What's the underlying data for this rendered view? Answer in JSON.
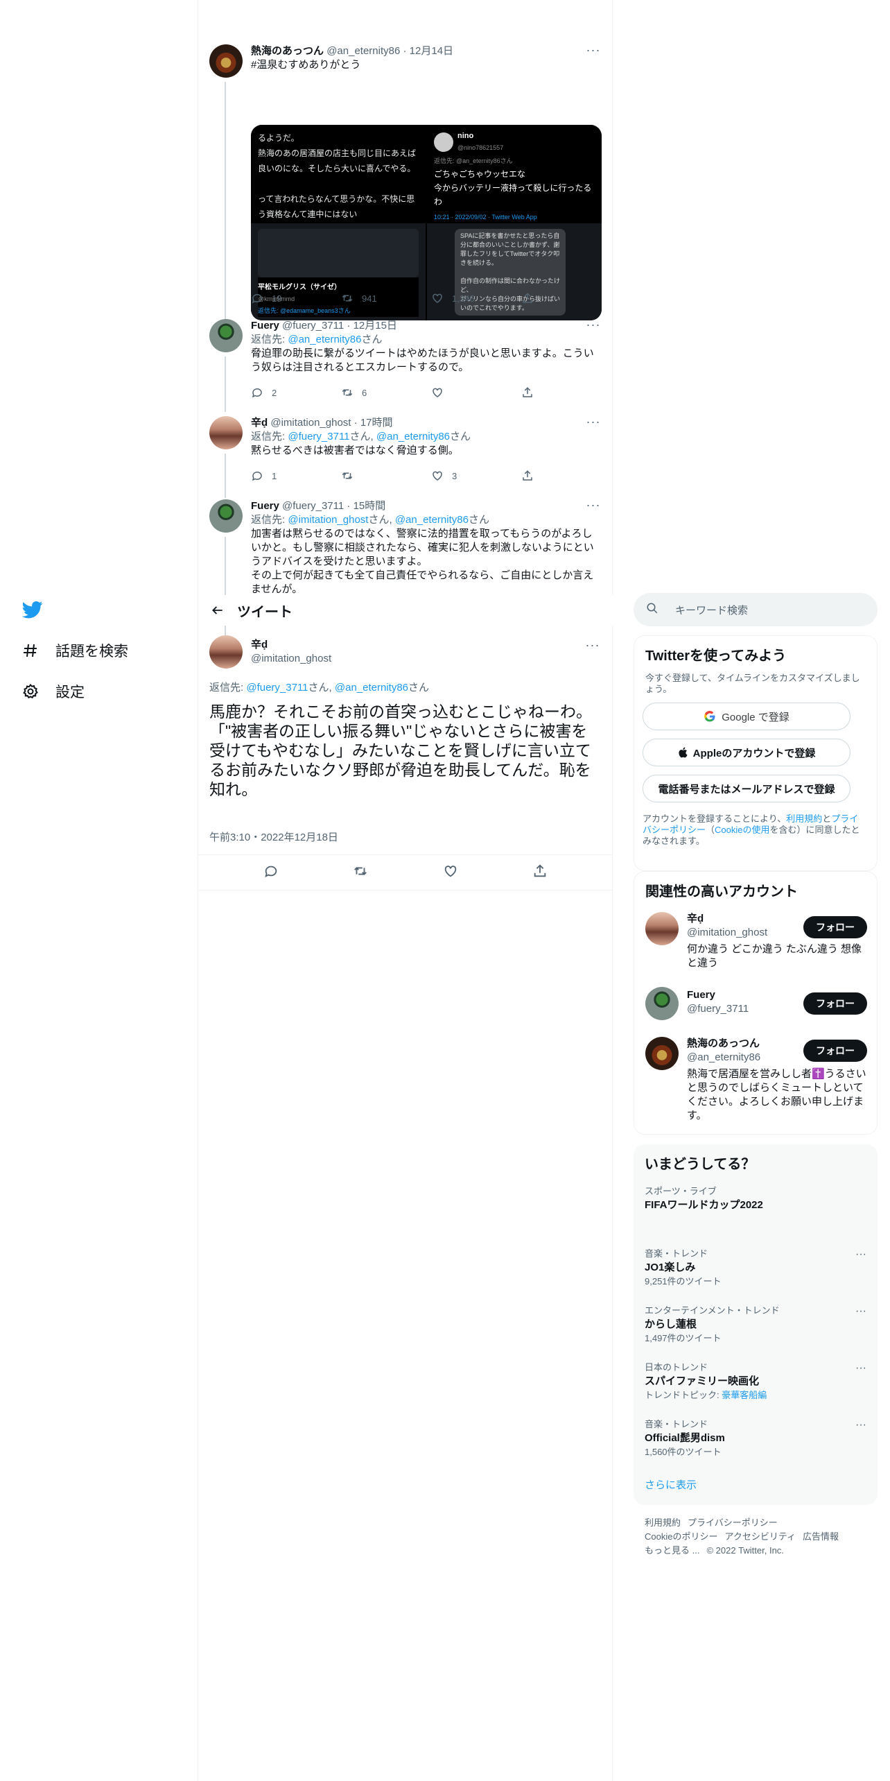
{
  "nav": {
    "explore_label": "話題を検索",
    "settings_label": "設定"
  },
  "header": {
    "title": "ツイート"
  },
  "thread": [
    {
      "name": "熱海のあっつん",
      "handle": "@an_eternity86",
      "time": "12月14日",
      "hashtag": "#温泉むすめありがとう",
      "media": {
        "img1_text": "るようだ。\n熱海のあの居酒屋の店主も同じ目にあえば良いのにな。そしたら大いに喜んでやる。\n\nって言われたらなんて思うかな。不快に思う資格なんて連中にはない",
        "img2_name": "nino",
        "img2_handle": "@nino78621557",
        "img2_reply": "返信先: @an_eternity86さん",
        "img2_text": "ごちゃごちゃウッセエな\n今からバッテリー液持って殺しに行ったるわ",
        "img2_meta": "10:21 · 2022/09/02 · Twitter Web App",
        "img3_name": "平松モルグリス（サイゼ）",
        "img3_handle": "@kmmkmmd",
        "img3_reply": "返信先: @edamame_beans3さん",
        "img4_text": "SPAに記事を書かせたと思ったら自分に都合のいいことしか書かず、謝罪したフリをしてTwitterでオタク叩きを続ける。\n\n自作自の制作は間に合わなかったけど、\nガソリンなら自分の車から抜けばいいのでこれでやります。"
      },
      "replies": "19",
      "retweets": "941",
      "likes": "1,346"
    },
    {
      "name": "Fuery",
      "handle": "@fuery_3711",
      "time": "12月15日",
      "reply_prefix": "返信先: ",
      "reply_to": "@an_eternity86",
      "reply_suffix": "さん",
      "text": "脅迫罪の助長に繋がるツイートはやめたほうが良いと思いますよ。こういう奴らは注目されるとエスカレートするので。",
      "replies": "2",
      "retweets": "6",
      "likes": ""
    },
    {
      "name": "辛ḍ",
      "handle": "@imitation_ghost",
      "time": "17時間",
      "reply_prefix": "返信先: ",
      "reply_to": "@fuery_3711",
      "reply_mid": "さん, ",
      "reply_to2": "@an_eternity86",
      "reply_suffix": "さん",
      "text": "黙らせるべきは被害者ではなく脅迫する側。",
      "replies": "1",
      "retweets": "",
      "likes": "3"
    },
    {
      "name": "Fuery",
      "handle": "@fuery_3711",
      "time": "15時間",
      "reply_prefix": "返信先: ",
      "reply_to": "@imitation_ghost",
      "reply_mid": "さん, ",
      "reply_to2": "@an_eternity86",
      "reply_suffix": "さん",
      "text": "加害者は黙らせるのではなく、警察に法的措置を取ってもらうのがよろしいかと。もし警察に相談されたなら、確実に犯人を刺激しないようにというアドバイスを受けたと思いますよ。\nその上で何が起きても全て自己責任でやられるなら、ご自由にとしか言えませんが。"
    }
  ],
  "focus": {
    "name": "辛ḍ",
    "handle": "@imitation_ghost",
    "reply_prefix": "返信先: ",
    "reply_to": "@fuery_3711",
    "reply_mid": "さん, ",
    "reply_to2": "@an_eternity86",
    "reply_suffix": "さん",
    "text": "馬鹿か？それこそお前の首突っ込むとこじゃねーわ。\n「\"被害者の正しい振る舞い\"じゃないとさらに被害を受けてもやむなし」みたいなことを賢しげに言い立てるお前みたいなクソ野郎が脅迫を助長してんだ。恥を知れ。",
    "timestamp": "午前3:10・2022年12月18日"
  },
  "search": {
    "placeholder": "キーワード検索"
  },
  "signup": {
    "title": "Twitterを使ってみよう",
    "subtitle": "今すぐ登録して、タイムラインをカスタマイズしましょう。",
    "google": "Google で登録",
    "apple": "Appleのアカウントで登録",
    "phone": "電話番号またはメールアドレスで登録",
    "terms_prefix": "アカウントを登録することにより、",
    "terms_link1": "利用規約",
    "terms_mid1": "と",
    "terms_link2": "プライバシーポリシー",
    "terms_mid2": "（",
    "terms_link3": "Cookieの使用",
    "terms_suffix": "を含む）に同意したとみなされます。"
  },
  "related": {
    "title": "関連性の高いアカウント",
    "follow_label": "フォロー",
    "users": [
      {
        "name": "辛ḍ",
        "handle": "@imitation_ghost",
        "bio": "何か違う どこか違う たぶん違う 想像と違う"
      },
      {
        "name": "Fuery",
        "handle": "@fuery_3711",
        "bio": ""
      },
      {
        "name": "熱海のあっつん",
        "handle": "@an_eternity86",
        "bio": "熱海で居酒屋を営みしし者✝️うるさいと思うのでしばらくミュートしといてください。よろしくお願い申し上げます。"
      }
    ]
  },
  "trends": {
    "title": "いまどうしてる？",
    "items": [
      {
        "category": "スポーツ・ライブ",
        "name": "FIFAワールドカップ2022",
        "count": ""
      },
      {
        "category": "音楽・トレンド",
        "name": "JO1楽しみ",
        "count": "9,251件のツイート"
      },
      {
        "category": "エンターテインメント・トレンド",
        "name": "からし蓮根",
        "count": "1,497件のツイート"
      },
      {
        "category": "日本のトレンド",
        "name": "スパイファミリー映画化",
        "topic_prefix": "トレンドトピック: ",
        "topic": "豪華客船編"
      },
      {
        "category": "音楽・トレンド",
        "name": "Official髭男dism",
        "count": "1,560件のツイート"
      }
    ],
    "show_more": "さらに表示"
  },
  "footer": {
    "terms": "利用規約",
    "privacy": "プライバシーポリシー",
    "cookie": "Cookieのポリシー",
    "accessibility": "アクセシビリティ",
    "ads": "広告情報",
    "more": "もっと見る ...",
    "copyright": "© 2022 Twitter, Inc."
  },
  "colors": {
    "accent": "#1d9bf0",
    "text": "#0f1419",
    "muted": "#536471"
  }
}
